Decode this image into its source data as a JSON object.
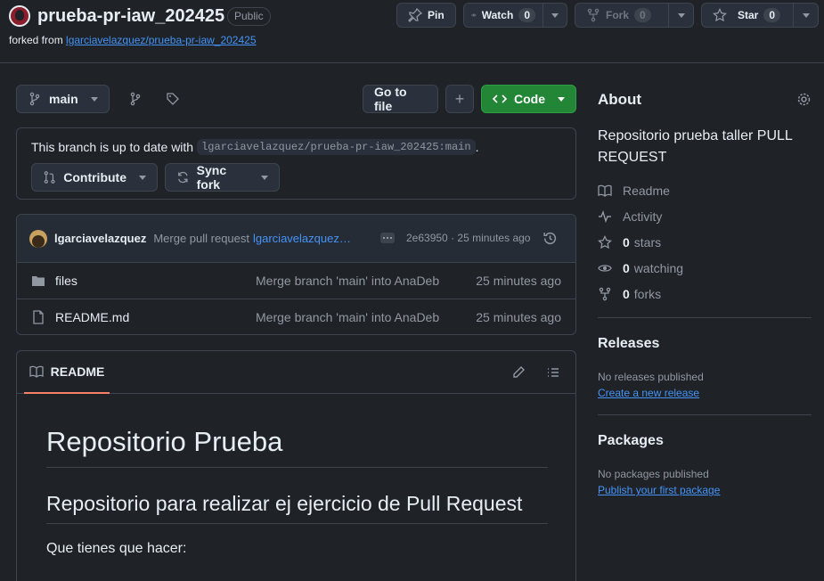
{
  "repo": {
    "name": "prueba-pr-iaw_202425",
    "visibility": "Public",
    "forked_prefix": "forked from ",
    "forked_from": "lgarciavelazquez/prueba-pr-iaw_202425"
  },
  "header_actions": {
    "pin": "Pin",
    "watch": "Watch",
    "watch_count": "0",
    "fork": "Fork",
    "fork_count": "0",
    "star": "Star",
    "star_count": "0"
  },
  "toolbar": {
    "branch": "main",
    "go_to_file": "Go to file",
    "add": "+",
    "code": "Code"
  },
  "branch_status": {
    "text": "This branch is up to date with",
    "ref": "lgarciavelazquez/prueba-pr-iaw_202425:main",
    "period": ".",
    "contribute": "Contribute",
    "sync_fork": "Sync fork"
  },
  "commit": {
    "author": "lgarciavelazquez",
    "message": "Merge pull request",
    "message_link": "lgarciavelazquez…",
    "hash": "2e63950",
    "dot": "·",
    "time": "25 minutes ago"
  },
  "files": [
    {
      "name": "files",
      "type": "folder",
      "message": "Merge branch 'main' into AnaDeb",
      "time": "25 minutes ago"
    },
    {
      "name": "README.md",
      "type": "file",
      "message": "Merge branch 'main' into AnaDeb",
      "time": "25 minutes ago"
    }
  ],
  "readme": {
    "tab": "README",
    "h1": "Repositorio Prueba",
    "h2": "Repositorio para realizar ej ejercicio de Pull Request",
    "p": "Que tienes que hacer:"
  },
  "about": {
    "title": "About",
    "description": "Repositorio prueba taller PULL REQUEST",
    "readme": "Readme",
    "activity": "Activity",
    "stars_count": "0",
    "stars_label": "stars",
    "watching_count": "0",
    "watching_label": "watching",
    "forks_count": "0",
    "forks_label": "forks"
  },
  "releases": {
    "title": "Releases",
    "none": "No releases published",
    "create": "Create a new release"
  },
  "packages": {
    "title": "Packages",
    "none": "No packages published",
    "publish": "Publish your first package"
  },
  "colors": {
    "bg": "#1f2328",
    "border": "#3d444d",
    "link": "#4493f8",
    "code_button": "#238636",
    "muted": "#9198a1",
    "readme_tab_underline": "#f78166"
  }
}
